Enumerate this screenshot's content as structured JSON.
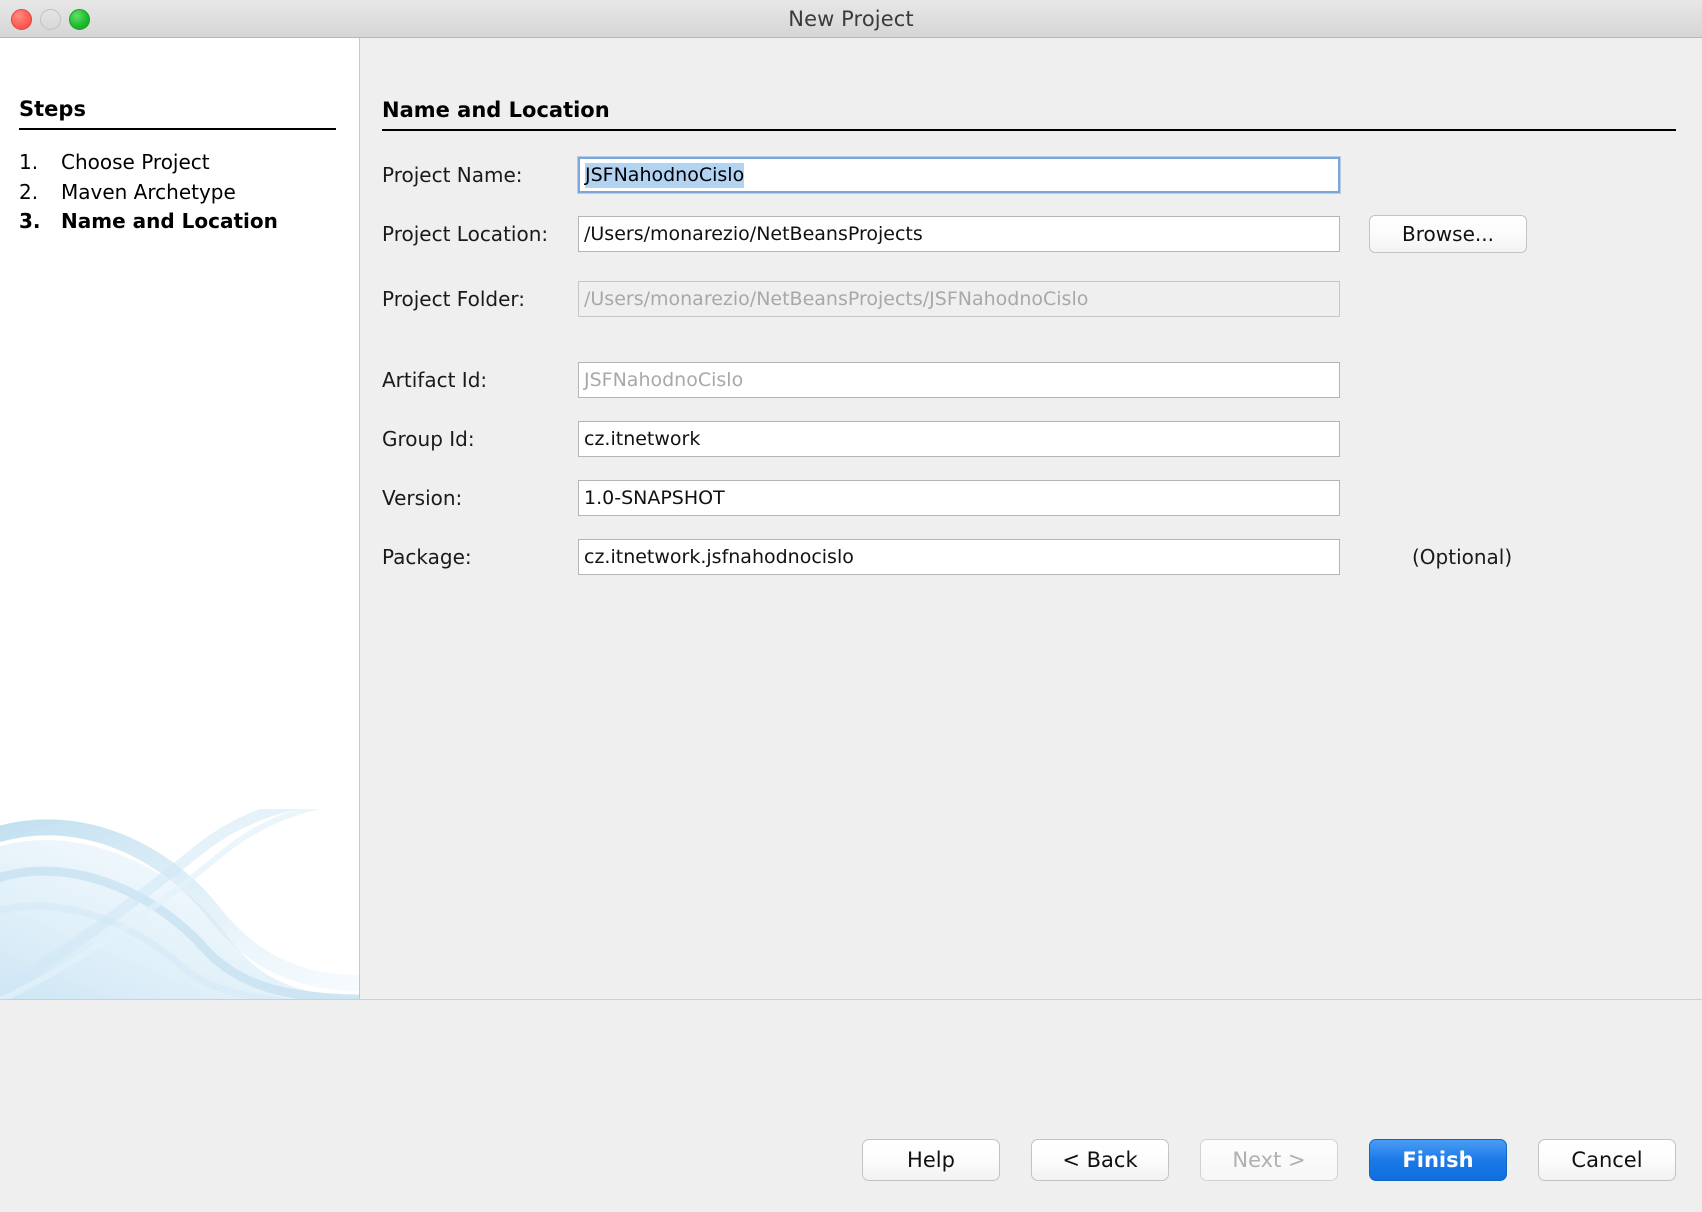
{
  "window": {
    "title": "New Project",
    "traffic_lights": [
      "close-button",
      "minimize-button",
      "maximize-button"
    ]
  },
  "sidebar": {
    "heading": "Steps",
    "steps": [
      {
        "num": "1.",
        "label": "Choose Project",
        "current": false
      },
      {
        "num": "2.",
        "label": "Maven Archetype",
        "current": false
      },
      {
        "num": "3.",
        "label": "Name and Location",
        "current": true
      }
    ]
  },
  "main": {
    "title": "Name and Location",
    "fields": [
      {
        "label": "Project Name:",
        "value": "JSFNahodnoCislo",
        "state": "focused-selected"
      },
      {
        "label": "Project Location:",
        "value": "/Users/monarezio/NetBeansProjects",
        "state": "normal"
      },
      {
        "label": "Project Folder:",
        "value": "/Users/monarezio/NetBeansProjects/JSFNahodnoCislo",
        "state": "disabled"
      },
      {
        "label": "Artifact Id:",
        "value": "JSFNahodnoCislo",
        "state": "grey-text"
      },
      {
        "label": "Group Id:",
        "value": "cz.itnetwork",
        "state": "normal"
      },
      {
        "label": "Version:",
        "value": "1.0-SNAPSHOT",
        "state": "normal"
      },
      {
        "label": "Package:",
        "value": "cz.itnetwork.jsfnahodnocislo",
        "state": "normal"
      }
    ],
    "browse_label": "Browse...",
    "optional_note": "(Optional)"
  },
  "footer": {
    "buttons": [
      {
        "label": "Help",
        "state": "normal"
      },
      {
        "label": "< Back",
        "state": "normal"
      },
      {
        "label": "Next >",
        "state": "disabled"
      },
      {
        "label": "Finish",
        "state": "default"
      },
      {
        "label": "Cancel",
        "state": "normal"
      }
    ]
  },
  "colors": {
    "selection_blue": "#b2d3f2",
    "default_button_blue": "#1b7ae8",
    "focus_border": "#7aa7d8",
    "panel_bg": "#efefef",
    "sidebar_bg": "#ffffff",
    "swoosh": "#bcdcee"
  }
}
